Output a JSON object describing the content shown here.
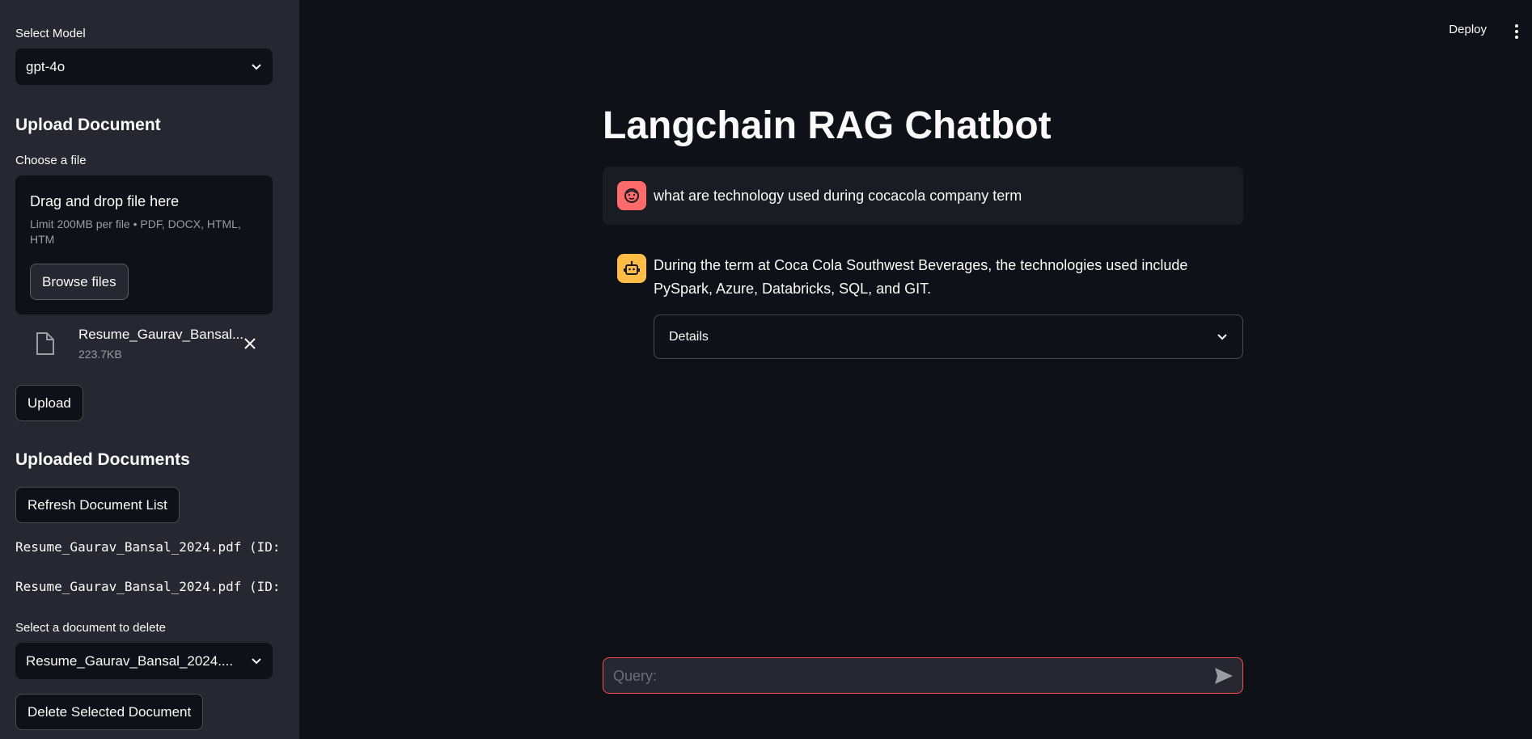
{
  "sidebar": {
    "select_model_label": "Select Model",
    "model_value": "gpt-4o",
    "upload_heading": "Upload Document",
    "choose_file_label": "Choose a file",
    "dropzone_title": "Drag and drop file here",
    "dropzone_limit": "Limit 200MB per file • PDF, DOCX, HTML, HTM",
    "browse_button": "Browse files",
    "uploaded_file": {
      "name": "Resume_Gaurav_Bansal...",
      "size": "223.7KB"
    },
    "upload_button": "Upload",
    "uploaded_heading": "Uploaded Documents",
    "refresh_button": "Refresh Document List",
    "documents": [
      "Resume_Gaurav_Bansal_2024.pdf (ID:",
      "Resume_Gaurav_Bansal_2024.pdf (ID:"
    ],
    "delete_select_label": "Select a document to delete",
    "delete_select_value": "Resume_Gaurav_Bansal_2024....",
    "delete_button": "Delete Selected Document"
  },
  "header": {
    "deploy_label": "Deploy"
  },
  "main": {
    "title": "Langchain RAG Chatbot",
    "messages": [
      {
        "role": "user",
        "text": "what are technology used during cocacola company term"
      },
      {
        "role": "assistant",
        "text": "During the term at Coca Cola Southwest Beverages, the technologies used include PySpark, Azure, Databricks, SQL, and GIT."
      }
    ],
    "details_label": "Details",
    "chat_placeholder": "Query:"
  },
  "colors": {
    "background": "#0e1117",
    "sidebar": "#262730",
    "user_avatar": "#ff6b6b",
    "assistant_avatar": "#ffbd45",
    "input_border": "#ff4b4b"
  }
}
